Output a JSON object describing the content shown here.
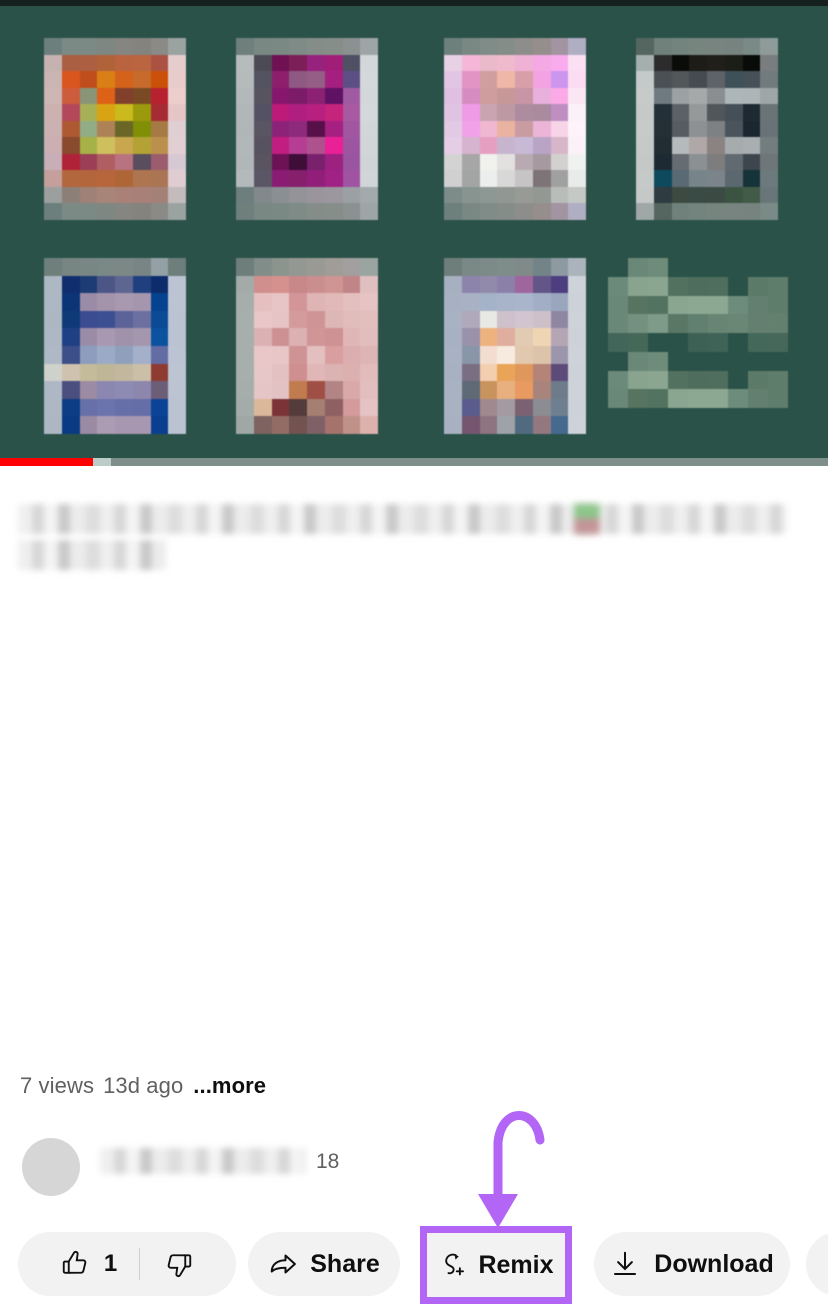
{
  "player": {
    "background_color": "#2a5249",
    "progress": {
      "played_percent": 11.2,
      "buffered_percent": 13.4,
      "played_color": "#ff0000",
      "buffer_color": "#bcccc8",
      "track_color": "#7d8e8b"
    },
    "thumbnails": [
      {
        "name": "thumbnail-1",
        "cols": 8,
        "rows": 11,
        "colors": [
          "#6d7f7c",
          "#7c8a86",
          "#7b8a84",
          "#7e8781",
          "#858581",
          "#84837e",
          "#8a8a86",
          "#9ba3a0",
          "#c6b2b0",
          "#ab5f42",
          "#ac5f41",
          "#b06239",
          "#ba633f",
          "#ba6440",
          "#ab5243",
          "#e6cdcd",
          "#cbb5b3",
          "#d9561f",
          "#c04e1c",
          "#da7f16",
          "#d4621b",
          "#c76b2c",
          "#cb5109",
          "#e8cccb",
          "#cdb6b4",
          "#cd5c3d",
          "#8a9578",
          "#dd6117",
          "#80402c",
          "#7a4a25",
          "#b8212f",
          "#eccfcc",
          "#cdb1b0",
          "#b2485a",
          "#a8b057",
          "#d9a412",
          "#cbba1d",
          "#9a9a0c",
          "#a72b33",
          "#e6c5c6",
          "#cbb1b2",
          "#ad5a33",
          "#92ac85",
          "#ac8256",
          "#6a6627",
          "#808f06",
          "#a67a45",
          "#e0cfd2",
          "#cbafb2",
          "#8a4a2e",
          "#a6b248",
          "#cfc05e",
          "#c8a74f",
          "#b4a334",
          "#bb904c",
          "#e2cfd4",
          "#c8aeb6",
          "#b02237",
          "#9a3f55",
          "#b05e62",
          "#b9727f",
          "#5a4e5e",
          "#9b5c6e",
          "#d7c9d4",
          "#c59f9c",
          "#b3673c",
          "#b3663c",
          "#b6663a",
          "#ae6637",
          "#ae7550",
          "#aa7553",
          "#e0cdd2",
          "#9ba09e",
          "#8b7f78",
          "#a08177",
          "#a98479",
          "#aa8176",
          "#a88077",
          "#a48177",
          "#c4bcbc"
        ]
      },
      {
        "name": "thumbnail-2",
        "cols": 8,
        "rows": 11,
        "colors": [
          "#6e7f7c",
          "#7a8884",
          "#7b8985",
          "#7e8b86",
          "#848d88",
          "#868e89",
          "#8b9090",
          "#9ea5a6",
          "#b6bcbc",
          "#4c4b55",
          "#6f1152",
          "#7c1f58",
          "#96227d",
          "#a11e78",
          "#4f5063",
          "#d3d7d9",
          "#b5bbbb",
          "#545362",
          "#8d1f6c",
          "#8e5a84",
          "#945e86",
          "#a41f7f",
          "#5d4f86",
          "#d4d8da",
          "#b3b9bb",
          "#58545f",
          "#86176d",
          "#7c1b67",
          "#8c2173",
          "#5f1263",
          "#9f5aa1",
          "#d3d7d9",
          "#b1b7b9",
          "#555164",
          "#be1a7a",
          "#b01e80",
          "#b7207f",
          "#c6237d",
          "#a75aa1",
          "#d4d8da",
          "#b0b6b8",
          "#5a5563",
          "#8d2378",
          "#8e2a7b",
          "#571049",
          "#a62082",
          "#a256a0",
          "#d2d6d8",
          "#b2b8ba",
          "#57525f",
          "#c21d80",
          "#b53d94",
          "#ae528e",
          "#ea2196",
          "#9d55a2",
          "#d1d5d7",
          "#b1b7b9",
          "#59545f",
          "#6d1257",
          "#3e0e39",
          "#79216d",
          "#9d2181",
          "#9a55a0",
          "#d0d4d6",
          "#b4babc",
          "#5a5665",
          "#8a1d73",
          "#86206d",
          "#911f79",
          "#9f2284",
          "#a053a0",
          "#d1d5d7",
          "#6d7e7c",
          "#82898c",
          "#8a8f93",
          "#939398",
          "#9a959c",
          "#9c979e",
          "#9ba0a4",
          "#a2aaab"
        ]
      },
      {
        "name": "thumbnail-3",
        "cols": 8,
        "rows": 11,
        "colors": [
          "#6e807c",
          "#7a8884",
          "#7f8c87",
          "#858d88",
          "#8d8d8b",
          "#968e8d",
          "#a294a0",
          "#b0aec3",
          "#e7d1e4",
          "#f6b6d8",
          "#eab9ca",
          "#eebacc",
          "#efb1d4",
          "#f5a9e4",
          "#f9abee",
          "#fbe0f4",
          "#e2c5e4",
          "#e295c5",
          "#cf9e9e",
          "#eeb7a7",
          "#d99fa8",
          "#f3a2e2",
          "#cc96ee",
          "#fbdcf3",
          "#dfbfe2",
          "#d78cc1",
          "#cf9d9e",
          "#c79898",
          "#c795a5",
          "#e8b1dd",
          "#fba9e7",
          "#fbe6f4",
          "#e0c3e3",
          "#ef9be5",
          "#c9a5b1",
          "#bd9aa3",
          "#ad8c9f",
          "#a98a9e",
          "#be8fc0",
          "#fbf1f8",
          "#e2c9e4",
          "#f0a1e8",
          "#efb7d0",
          "#eab2a1",
          "#c99ca2",
          "#ecb5d7",
          "#f8d4e8",
          "#fdf3f9",
          "#e5cde6",
          "#d6b3cf",
          "#e69fc1",
          "#c7b5cf",
          "#c8b9d7",
          "#b9a4c5",
          "#d7b6c9",
          "#faf2f7",
          "#d4d3d3",
          "#a6a6a6",
          "#f1f2ee",
          "#e2e1df",
          "#b8aab0",
          "#a69aa0",
          "#d3d1d0",
          "#f0f2f1",
          "#cfd0cf",
          "#a3a5a4",
          "#eceeed",
          "#d7d8d7",
          "#c6c4c4",
          "#7e7478",
          "#a0a0a0",
          "#e9ebea",
          "#7d8c88",
          "#889490",
          "#8d9793",
          "#919894",
          "#989a96",
          "#949895",
          "#b9bdb9",
          "#c5c8c5"
        ]
      },
      {
        "name": "thumbnail-4",
        "cols": 8,
        "rows": 11,
        "colors": [
          "#55655f",
          "#70817c",
          "#73847f",
          "#77857f",
          "#788480",
          "#76837e",
          "#7a8a86",
          "#8e9b98",
          "#a5b0ae",
          "#2c2c2d",
          "#0a0c0a",
          "#1d1c16",
          "#201f1a",
          "#1b1d17",
          "#090b09",
          "#797d7d",
          "#c4cac9",
          "#4a5054",
          "#52575a",
          "#454c51",
          "#5f6267",
          "#3e5159",
          "#455057",
          "#717a7c",
          "#c6cbca",
          "#6f7a80",
          "#9ba2a4",
          "#a6a9a9",
          "#8a8e90",
          "#adb6b9",
          "#adb5b7",
          "#9ea6a7",
          "#c5cac9",
          "#233038",
          "#5b6167",
          "#95999a",
          "#50565a",
          "#454f58",
          "#1e2a31",
          "#6a7376",
          "#c6cbca",
          "#242f36",
          "#565c62",
          "#8d9194",
          "#7d8184",
          "#4a545c",
          "#1b2730",
          "#697276",
          "#c5cac9",
          "#222c33",
          "#b5babd",
          "#b0a8a8",
          "#8a8382",
          "#a6acae",
          "#a9afb1",
          "#737c7f",
          "#c4c9c8",
          "#1d2a33",
          "#666d72",
          "#8b9093",
          "#7e7d7d",
          "#616a70",
          "#3c464c",
          "#6e7679",
          "#c5cac9",
          "#0e4a5e",
          "#5a6a74",
          "#77858a",
          "#7a848a",
          "#5c686f",
          "#17333a",
          "#6d7a7d",
          "#c4c9c8",
          "#2e3b40",
          "#3c4a42",
          "#3a4a45",
          "#3b4b44",
          "#3b5442",
          "#425b47",
          "#68767a",
          "#9fa8a6"
        ]
      },
      {
        "name": "thumbnail-5",
        "cols": 8,
        "rows": 10,
        "colors": [
          "#6e7f7c",
          "#778583",
          "#788684",
          "#7a8886",
          "#7c8886",
          "#798585",
          "#93a0a6",
          "#6d7e7b",
          "#aeb7c4",
          "#102d6e",
          "#1d3b74",
          "#4b5687",
          "#5c6690",
          "#203f7f",
          "#0d2c6b",
          "#bcc4d4",
          "#aeb7c4",
          "#0b3577",
          "#9a8ca6",
          "#a394ab",
          "#a999b0",
          "#a696ad",
          "#05428f",
          "#bcc4d4",
          "#adb6c3",
          "#0e3a78",
          "#3c4c90",
          "#3d4f93",
          "#5b6399",
          "#6b70a1",
          "#0b4b95",
          "#bbc3d3",
          "#aeb7c4",
          "#204086",
          "#9a8ca7",
          "#a998b1",
          "#a192ab",
          "#a496ad",
          "#0b529f",
          "#bbc3d3",
          "#afb8c5",
          "#3d4f89",
          "#8e9dbe",
          "#9cabc5",
          "#8fa0bd",
          "#a4b0c9",
          "#646ca4",
          "#bcc4d4",
          "#cfd2cb",
          "#cfc2ae",
          "#c4bb9a",
          "#bfb698",
          "#c3b79e",
          "#cbbfa7",
          "#8e3c31",
          "#bdc5d3",
          "#aeb8c5",
          "#4a4f80",
          "#9b8ba3",
          "#8b87b1",
          "#8d8ab3",
          "#8d87ae",
          "#6d5e78",
          "#bcc4d4",
          "#aeb7c4",
          "#0c3d85",
          "#6770a8",
          "#6b74ad",
          "#666fa8",
          "#656ea7",
          "#0b4396",
          "#bbc3d3",
          "#adb7c4",
          "#0b3a84",
          "#9a8aa4",
          "#ab9bb3",
          "#a897b0",
          "#a897b0",
          "#0a3f90",
          "#bbc3d3"
        ]
      },
      {
        "name": "thumbnail-6",
        "cols": 8,
        "rows": 10,
        "colors": [
          "#6e7e7b",
          "#818d89",
          "#8c948e",
          "#949893",
          "#9a9a94",
          "#a09c97",
          "#a2a09f",
          "#9aa5a2",
          "#a3aba9",
          "#d08f8c",
          "#d4918d",
          "#c8888a",
          "#cb8e8e",
          "#ce9593",
          "#c28587",
          "#e0bfc1",
          "#a6aeac",
          "#e6c0c1",
          "#e7c4c5",
          "#d39597",
          "#dfb4b4",
          "#e0b9b8",
          "#e3bfbe",
          "#e5c4c3",
          "#a7afad",
          "#e9c6c7",
          "#e6c3c4",
          "#d39b9c",
          "#cf9495",
          "#ddb6b6",
          "#e1bcbb",
          "#e2bebd",
          "#a7afad",
          "#dcb1b3",
          "#cd9193",
          "#dcb1b2",
          "#d09596",
          "#cf9294",
          "#dfb6b5",
          "#e2bdbd",
          "#a7afad",
          "#e9c7c9",
          "#e8c5c7",
          "#d09395",
          "#e4bfbf",
          "#d99fa0",
          "#dcadae",
          "#ddb5b4",
          "#a7afad",
          "#e8c7c9",
          "#e3c0c1",
          "#cf8f90",
          "#e0b7b6",
          "#dbb3b3",
          "#ddb0b0",
          "#e1bcbb",
          "#a6aeac",
          "#e5c5c6",
          "#e2c2c2",
          "#c07b4e",
          "#9f4f44",
          "#b38486",
          "#d9a8a8",
          "#e2bfbe",
          "#a4acaa",
          "#dcb89a",
          "#7c3338",
          "#553c3c",
          "#a47f72",
          "#8e6061",
          "#d39b9c",
          "#e5c3c4",
          "#a0a8a6",
          "#7e6360",
          "#936d65",
          "#72534f",
          "#7e6066",
          "#a5736c",
          "#bf9189",
          "#ddb1ac",
          "#b0a9a7"
        ]
      },
      {
        "name": "thumbnail-7",
        "cols": 8,
        "rows": 10,
        "colors": [
          "#6e7e7b",
          "#7a8886",
          "#7c8a88",
          "#7e8c8a",
          "#7f8a89",
          "#738488",
          "#8d9aa2",
          "#abb4bc",
          "#a7b0c0",
          "#8d84ac",
          "#928aab",
          "#8b80aa",
          "#9f659d",
          "#635587",
          "#4d3f7f",
          "#ced3da",
          "#a8b1c1",
          "#a9b1c4",
          "#a5b3c9",
          "#a8b4ca",
          "#a9b5cb",
          "#a1aec6",
          "#9aa6be",
          "#cdd2d9",
          "#a9b2c2",
          "#b0a8bb",
          "#e8e9e4",
          "#cfc1cc",
          "#d2c5d0",
          "#cec0c9",
          "#8f86a2",
          "#ced3da",
          "#a8b1c1",
          "#9a91ab",
          "#eeb27f",
          "#dfae9f",
          "#e2cbb3",
          "#f0d5b4",
          "#b5a6b5",
          "#cdd2d9",
          "#a9b2c2",
          "#8995a8",
          "#f2ddd0",
          "#f7eadf",
          "#e1c8ae",
          "#dcc4aa",
          "#9b96ab",
          "#ced3da",
          "#a8b1c1",
          "#7a6e83",
          "#f3cfb0",
          "#eaa458",
          "#e0975b",
          "#b58377",
          "#5c4b79",
          "#cdd2d9",
          "#a9b2c2",
          "#5e6a75",
          "#c9935e",
          "#e8b07e",
          "#e99a61",
          "#a9847c",
          "#6e7b8a",
          "#ced3da",
          "#a9b2c2",
          "#595c8c",
          "#a2888f",
          "#a39aa2",
          "#7b6272",
          "#8c8c93",
          "#6e7f90",
          "#cdd2d9",
          "#a8b1c1",
          "#75556f",
          "#8e7380",
          "#9da3a9",
          "#526a80",
          "#94787f",
          "#46698e",
          "#ced3da"
        ]
      },
      {
        "name": "thumbnail-8-text",
        "cols": 10,
        "rows": 8,
        "colors": [
          "#2a5249",
          "#6a8878",
          "#6f8c7b",
          "#2a5249",
          "#2a5249",
          "#2a5249",
          "#2a5249",
          "#2a5249",
          "#2a5249",
          "#2a5249",
          "#6b8a7a",
          "#88a48f",
          "#8aa691",
          "#52715f",
          "#4e6d5c",
          "#4f6e5d",
          "#2a5249",
          "#5c7a68",
          "#5f7d6b",
          "#2a5249",
          "#6a8878",
          "#56745f",
          "#52735f",
          "#8aa691",
          "#8ca893",
          "#8ca893",
          "#6e8c7b",
          "#637f6e",
          "#5f7d6b",
          "#2a5249",
          "#6a8878",
          "#74917f",
          "#7e9a88",
          "#5a7766",
          "#628070",
          "#688574",
          "#6a8776",
          "#657f6f",
          "#63806e",
          "#2a5249",
          "#43665a",
          "#456859",
          "#2a5249",
          "#2a5249",
          "#3d6154",
          "#3f6356",
          "#2a5249",
          "#44685a",
          "#45685a",
          "#2a5249"
        ]
      }
    ]
  },
  "video": {
    "title_redacted": true,
    "views": "7 views",
    "published": "13d ago",
    "more_label": "...more"
  },
  "channel": {
    "name_redacted": true,
    "subscriber_count": "18"
  },
  "actions": {
    "like": {
      "name": "like",
      "count": "1",
      "icon": "thumbs-up-icon"
    },
    "dislike": {
      "name": "dislike",
      "icon": "thumbs-down-icon"
    },
    "share": {
      "label": "Share",
      "icon": "share-arrow-icon"
    },
    "remix": {
      "label": "Remix",
      "icon": "remix-icon",
      "highlighted": true,
      "highlight_color": "#b366f5"
    },
    "download": {
      "label": "Download",
      "icon": "download-arrow-icon"
    }
  },
  "annotation": {
    "arrow_color": "#b366f5",
    "points_to": "remix"
  }
}
